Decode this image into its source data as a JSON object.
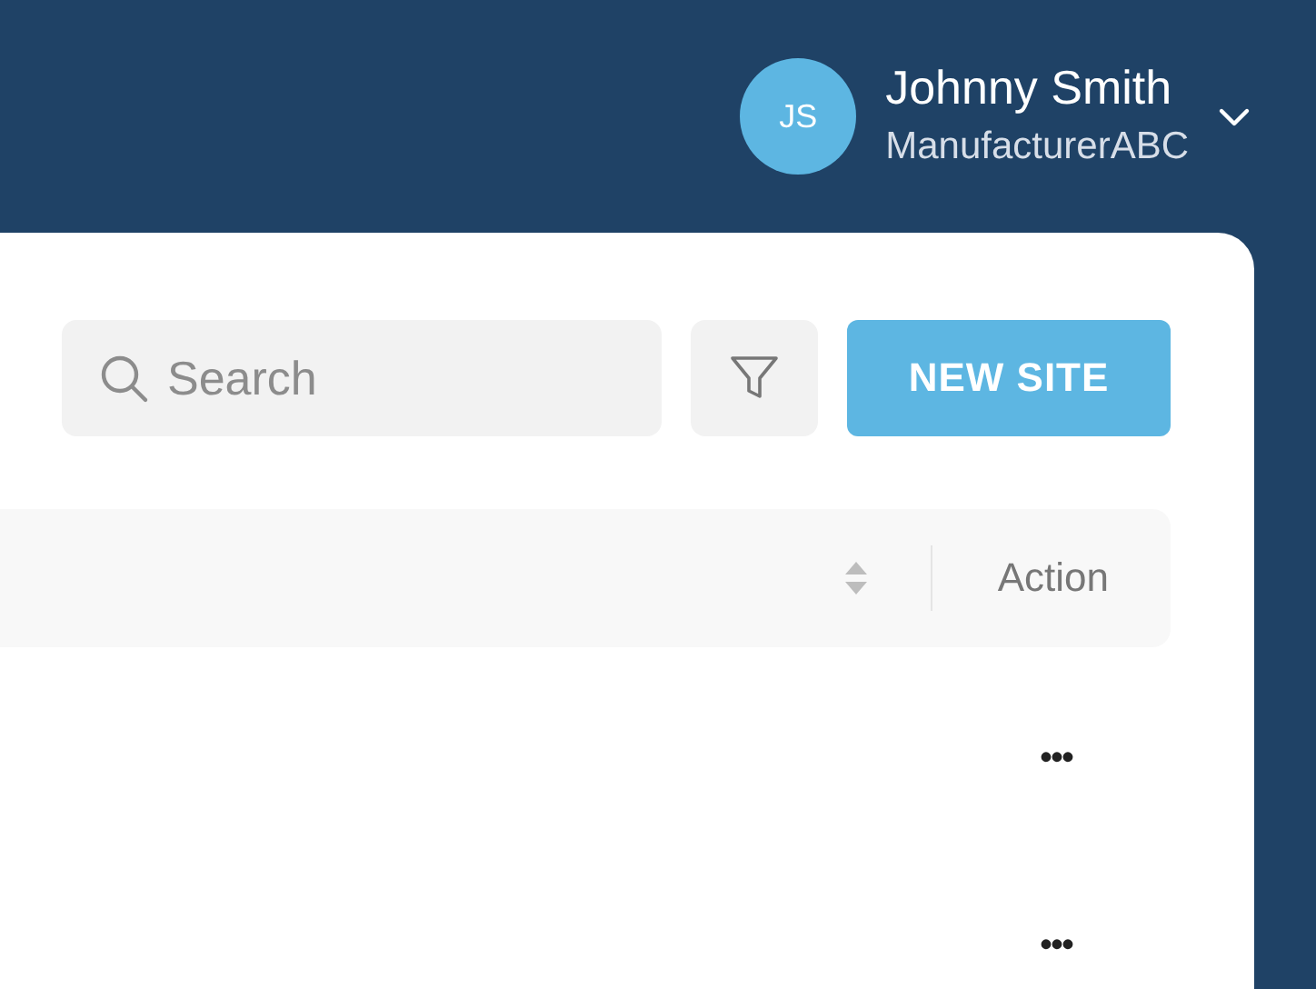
{
  "user": {
    "initials": "JS",
    "name": "Johnny Smith",
    "company": "ManufacturerABC"
  },
  "toolbar": {
    "search": {
      "placeholder": "Search"
    },
    "new_button": "NEW SITE"
  },
  "table": {
    "columns": [
      {
        "kind": "sort"
      },
      {
        "label": "Action",
        "kind": "text"
      }
    ],
    "rows": [
      {
        "action": "•••"
      },
      {
        "action": "•••"
      }
    ]
  }
}
